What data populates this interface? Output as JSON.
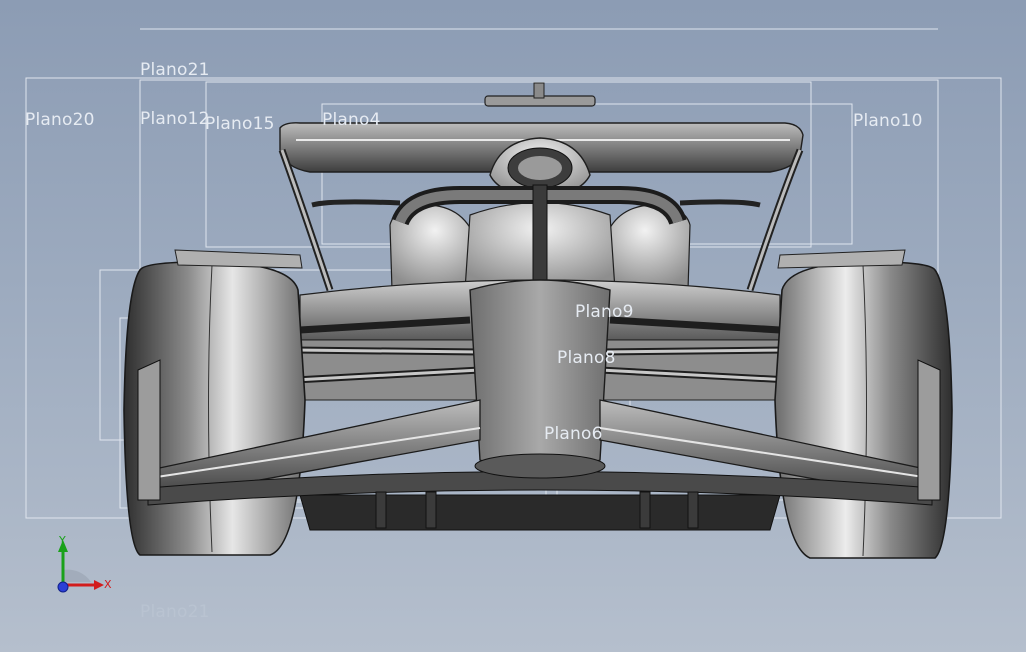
{
  "viewport": {
    "background_top": "#8c9cb4",
    "background_bottom": "#b5bfcd"
  },
  "planes": {
    "plano20": "Plano20",
    "plano21_top": "Plano21",
    "plano12": "Plano12",
    "plano15": "Plano15",
    "plano4": "Plano4",
    "plano10": "Plano10",
    "plano9": "Plano9",
    "plano8": "Plano8",
    "plano6": "Plano6",
    "plano21_bottom": "Plano21"
  },
  "triad": {
    "x_label": "X",
    "y_label": "Y",
    "x_color": "#d21c1c",
    "y_color": "#1aa11a",
    "z_color": "#2b3fd6"
  },
  "model": {
    "icon": "f1-car-front-view",
    "shade_light": "#e9e9e9",
    "shade_dark": "#3a3a3a"
  }
}
